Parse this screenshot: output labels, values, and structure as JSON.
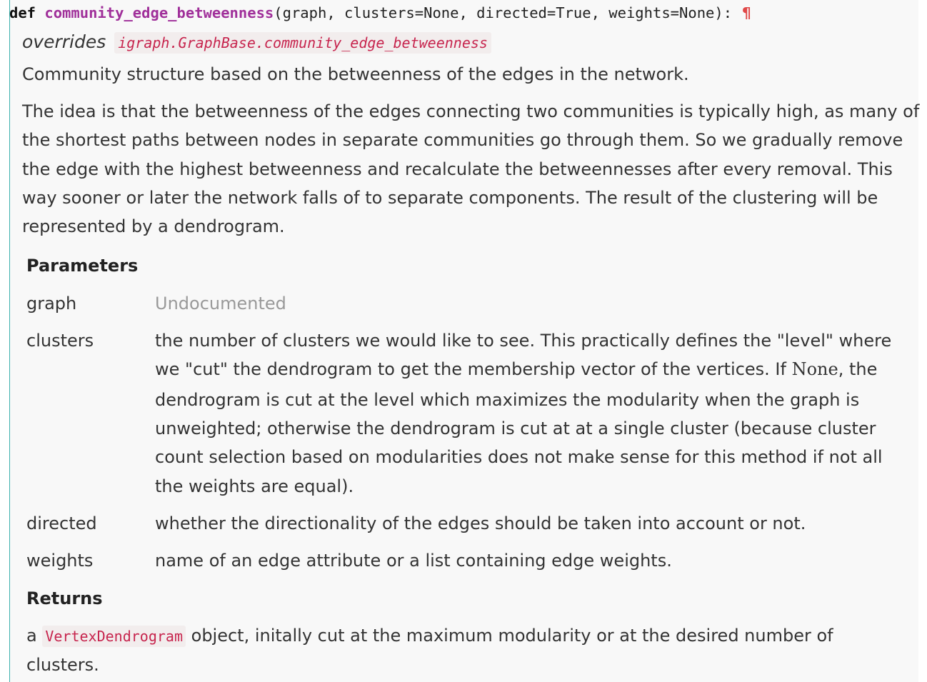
{
  "signature": {
    "keyword": "def",
    "function_name": "community_edge_betweenness",
    "params_text": "(graph, clusters=None, directed=True, weights=None):",
    "pilcrow": "¶"
  },
  "overrides": {
    "label": "overrides",
    "link": "igraph.GraphBase.community_edge_betweenness"
  },
  "summary": "Community structure based on the betweenness of the edges in the network.",
  "description_lines": [
    "The idea is that the betweenness of the edges connecting two communities is typically high, as many of",
    "the shortest paths between nodes in separate communities go through them. So we gradually remove",
    "the edge with the highest betweenness and recalculate the betweennesses after every removal. This",
    "way sooner or later the network falls of to separate components. The result of the clustering will be",
    "represented by a dendrogram."
  ],
  "parameters": {
    "heading": "Parameters",
    "graph": {
      "name": "graph",
      "desc": "Undocumented"
    },
    "clusters": {
      "name": "clusters",
      "line1": "the number of clusters we would like to see. This practically defines the \"level\" where",
      "line2_before": "we \"cut\" the dendrogram to get the membership vector of the vertices. If ",
      "line2_code": "None",
      "line2_after": ", the",
      "line3": "dendrogram is cut at the level which maximizes the modularity when the graph is",
      "line4": "unweighted; otherwise the dendrogram is cut at at a single cluster (because cluster",
      "line5": "count selection based on modularities does not make sense for this method if not all",
      "line6": "the weights are equal)."
    },
    "directed": {
      "name": "directed",
      "desc": "whether the directionality of the edges should be taken into account or not."
    },
    "weights": {
      "name": "weights",
      "desc": "name of an edge attribute or a list containing edge weights."
    }
  },
  "returns": {
    "heading": "Returns",
    "prefix": "a ",
    "code": "VertexDendrogram",
    "text": " object, initally cut at the maximum modularity or at the desired number of",
    "line2": "clusters."
  }
}
